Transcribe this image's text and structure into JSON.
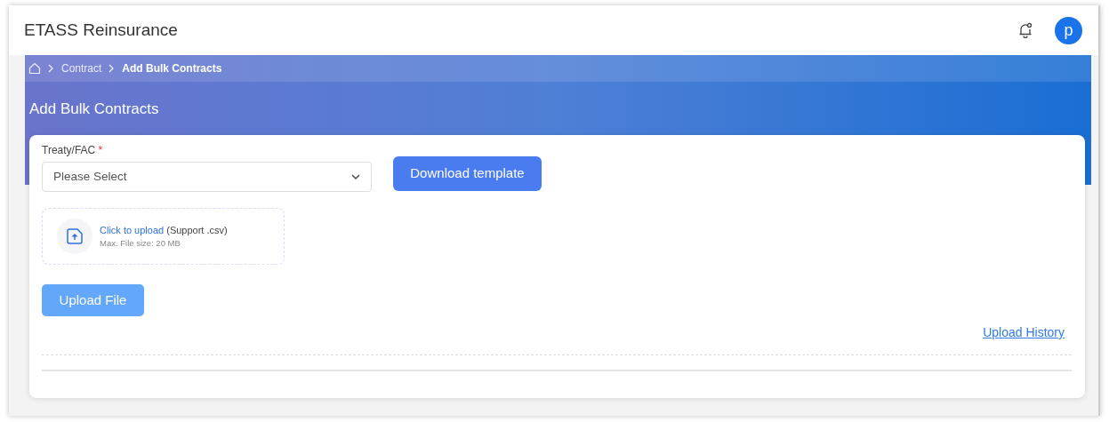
{
  "app": {
    "title": "ETASS Reinsurance",
    "avatar": "p"
  },
  "breadcrumb": [
    "Contract",
    "Add Bulk Contracts"
  ],
  "page_title": "Add Bulk Contracts",
  "form": {
    "label": "Treaty/FAC",
    "required": true,
    "required_mark": "*",
    "placeholder": "Please Select"
  },
  "download_button": "Download template",
  "upload_zone": {
    "link": "Click to upload",
    "note": "(Support .csv)",
    "limit": "Max. File size: 20 MB"
  },
  "upload_button": {
    "label": "Upload File",
    "disabled": true
  },
  "history_link": "Upload History"
}
